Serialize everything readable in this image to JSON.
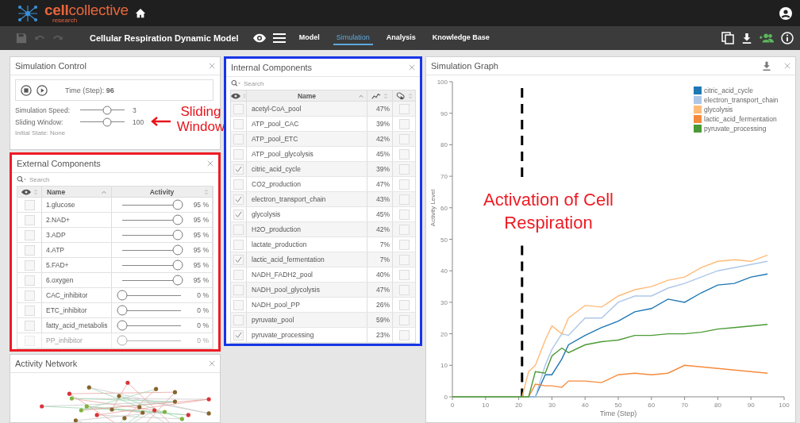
{
  "app": {
    "logo_bold": "cell",
    "logo_rest": "collective",
    "logo_sub": "research"
  },
  "toolbar": {
    "model_title": "Cellular Respiration Dynamic Model",
    "tabs": [
      {
        "label": "Model",
        "selected": false
      },
      {
        "label": "Simulation",
        "selected": true
      },
      {
        "label": "Analysis",
        "selected": false
      },
      {
        "label": "Knowledge Base",
        "selected": false
      }
    ]
  },
  "simulation_control": {
    "title": "Simulation Control",
    "time": "Time (Step): **96**",
    "sliders": [
      {
        "label": "Simulation Speed:",
        "level": 0.6,
        "reading": "3"
      },
      {
        "label": "Sliding Window:",
        "level": 0.6,
        "reading": "100"
      }
    ],
    "initial_state": "Initial State: None",
    "callout": "Sliding Window"
  },
  "external_components": {
    "title": "External Components",
    "highlighted": true,
    "search_placeholder": "Search",
    "columns": [
      "Name",
      "Activity"
    ],
    "rows": [
      {
        "name": "1.glucose",
        "visible": false,
        "level": 0.95,
        "reading": "95 %"
      },
      {
        "name": "2.NAD+",
        "visible": false,
        "level": 0.95,
        "reading": "95 %"
      },
      {
        "name": "3.ADP",
        "visible": false,
        "level": 0.95,
        "reading": "95 %"
      },
      {
        "name": "4.ATP",
        "visible": false,
        "level": 0.95,
        "reading": "95 %"
      },
      {
        "name": "5.FAD+",
        "visible": false,
        "level": 0.95,
        "reading": "95 %"
      },
      {
        "name": "6.oxygen",
        "visible": false,
        "level": 0.95,
        "reading": "95 %"
      },
      {
        "name": "CAC_inhibitor",
        "visible": false,
        "level": 0,
        "reading": "0 %"
      },
      {
        "name": "ETC_inhibitor",
        "visible": false,
        "level": 0,
        "reading": "0 %"
      },
      {
        "name": "fatty_acid_metabolis",
        "visible": false,
        "level": 0,
        "reading": "0 %"
      },
      {
        "name": "PP_inhibitor",
        "visible": false,
        "level": 0,
        "reading": "0 %"
      }
    ]
  },
  "activity_network": {
    "title": "Activity Network"
  },
  "internal_components": {
    "title": "Internal Components",
    "highlighted": true,
    "search_placeholder": "Search",
    "name_column": "Name",
    "rows": [
      {
        "name": "acetyl-CoA_pool",
        "visible": false,
        "activity": "47%",
        "pinned": false
      },
      {
        "name": "ATP_pool_CAC",
        "visible": false,
        "activity": "39%",
        "pinned": false
      },
      {
        "name": "ATP_pool_ETC",
        "visible": false,
        "activity": "42%",
        "pinned": false
      },
      {
        "name": "ATP_pool_glycolysis",
        "visible": false,
        "activity": "45%",
        "pinned": false
      },
      {
        "name": "citric_acid_cycle",
        "visible": true,
        "activity": "39%",
        "pinned": false
      },
      {
        "name": "CO2_production",
        "visible": false,
        "activity": "47%",
        "pinned": false
      },
      {
        "name": "electron_transport_chain",
        "visible": true,
        "activity": "43%",
        "pinned": false
      },
      {
        "name": "glycolysis",
        "visible": true,
        "activity": "45%",
        "pinned": false
      },
      {
        "name": "H2O_production",
        "visible": false,
        "activity": "42%",
        "pinned": false
      },
      {
        "name": "lactate_production",
        "visible": false,
        "activity": "7%",
        "pinned": false
      },
      {
        "name": "lactic_acid_fermentation",
        "visible": true,
        "activity": "7%",
        "pinned": false
      },
      {
        "name": "NADH_FADH2_pool",
        "visible": false,
        "activity": "40%",
        "pinned": false
      },
      {
        "name": "NADH_pool_glycolysis",
        "visible": false,
        "activity": "47%",
        "pinned": false
      },
      {
        "name": "NADH_pool_PP",
        "visible": false,
        "activity": "26%",
        "pinned": false
      },
      {
        "name": "pyruvate_pool",
        "visible": false,
        "activity": "59%",
        "pinned": false
      },
      {
        "name": "pyruvate_processing",
        "visible": true,
        "activity": "23%",
        "pinned": false
      }
    ]
  },
  "graph": {
    "title": "Simulation Graph",
    "callout": "Activation of Cell Respiration",
    "chart_data": {
      "type": "line",
      "xlabel": "Time (Step)",
      "ylabel": "Activity Level",
      "x": [
        0,
        20,
        21,
        23,
        25,
        28,
        30,
        33,
        35,
        40,
        45,
        50,
        55,
        60,
        65,
        70,
        75,
        80,
        85,
        90,
        95
      ],
      "series": [
        {
          "name": "citric_acid_cycle",
          "color": "#1f77b4",
          "values": [
            null,
            null,
            null,
            0,
            0,
            7,
            7,
            12,
            16.5,
            19.5,
            22,
            24,
            27,
            28,
            31,
            30,
            33,
            35.5,
            36,
            38,
            39
          ]
        },
        {
          "name": "electron_transport_chain",
          "color": "#aec7e8",
          "values": [
            null,
            null,
            null,
            0,
            0,
            10,
            15,
            20,
            19.5,
            25,
            25,
            30,
            32,
            32,
            34.5,
            36,
            38,
            40,
            41,
            42,
            43
          ]
        },
        {
          "name": "glycolysis",
          "color": "#ffbb78",
          "values": [
            null,
            null,
            0,
            8,
            10,
            18,
            22.5,
            20,
            25,
            29,
            28.5,
            32,
            34,
            35,
            37,
            38,
            41,
            43,
            43.5,
            43,
            45
          ]
        },
        {
          "name": "lactic_acid_fermentation",
          "color": "#f58a3c",
          "values": [
            null,
            null,
            null,
            0,
            4,
            3.5,
            3.5,
            3,
            5,
            5,
            4.5,
            7,
            7.5,
            7,
            7.5,
            10,
            9.5,
            9,
            8.5,
            8,
            7.5
          ]
        },
        {
          "name": "pyruvate_processing",
          "color": "#4b9a35",
          "values": [
            0,
            0,
            0,
            0,
            8,
            7.5,
            13,
            15.5,
            14,
            16.5,
            17.5,
            18,
            19.5,
            19.5,
            20,
            20,
            20.5,
            21.5,
            22,
            22.5,
            23
          ]
        }
      ],
      "xlim": [
        0,
        100
      ],
      "ylim": [
        0,
        100
      ],
      "xticks": [
        0,
        10,
        20,
        30,
        40,
        50,
        60,
        70,
        80,
        90,
        100
      ],
      "yticks": [
        0,
        10,
        20,
        30,
        40,
        50,
        60,
        70,
        80,
        90,
        100
      ],
      "legend": true,
      "ref_lines": [
        {
          "axis": "x",
          "value": 21
        }
      ]
    }
  }
}
